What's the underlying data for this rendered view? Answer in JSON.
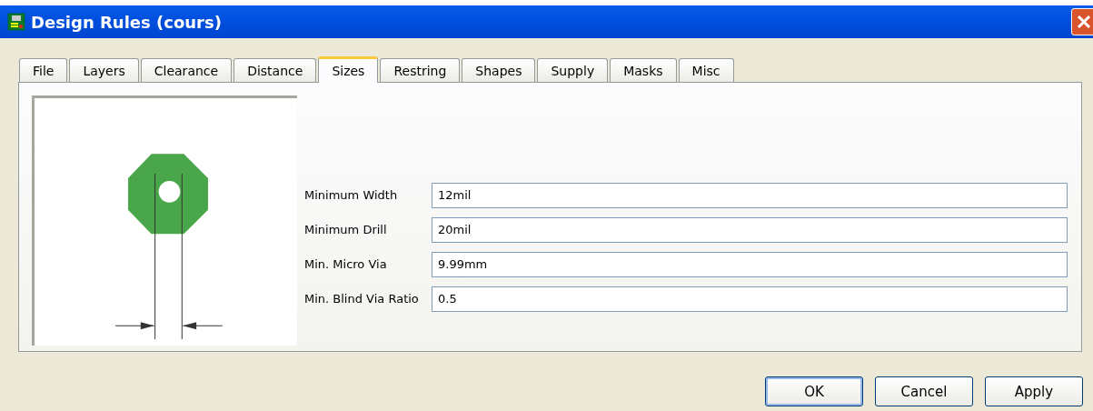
{
  "window": {
    "title": "Design Rules (cours)"
  },
  "tabs": [
    {
      "label": "File",
      "selected": false
    },
    {
      "label": "Layers",
      "selected": false
    },
    {
      "label": "Clearance",
      "selected": false
    },
    {
      "label": "Distance",
      "selected": false
    },
    {
      "label": "Sizes",
      "selected": true
    },
    {
      "label": "Restring",
      "selected": false
    },
    {
      "label": "Shapes",
      "selected": false
    },
    {
      "label": "Supply",
      "selected": false
    },
    {
      "label": "Masks",
      "selected": false
    },
    {
      "label": "Misc",
      "selected": false
    }
  ],
  "fields": [
    {
      "label": "Minimum Width",
      "value": "12mil"
    },
    {
      "label": "Minimum Drill",
      "value": "20mil"
    },
    {
      "label": "Min. Micro Via",
      "value": "9.99mm"
    },
    {
      "label": "Min. Blind Via Ratio",
      "value": "0.5"
    }
  ],
  "buttons": [
    {
      "label": "OK",
      "default": true
    },
    {
      "label": "Cancel",
      "default": false
    },
    {
      "label": "Apply",
      "default": false
    }
  ]
}
